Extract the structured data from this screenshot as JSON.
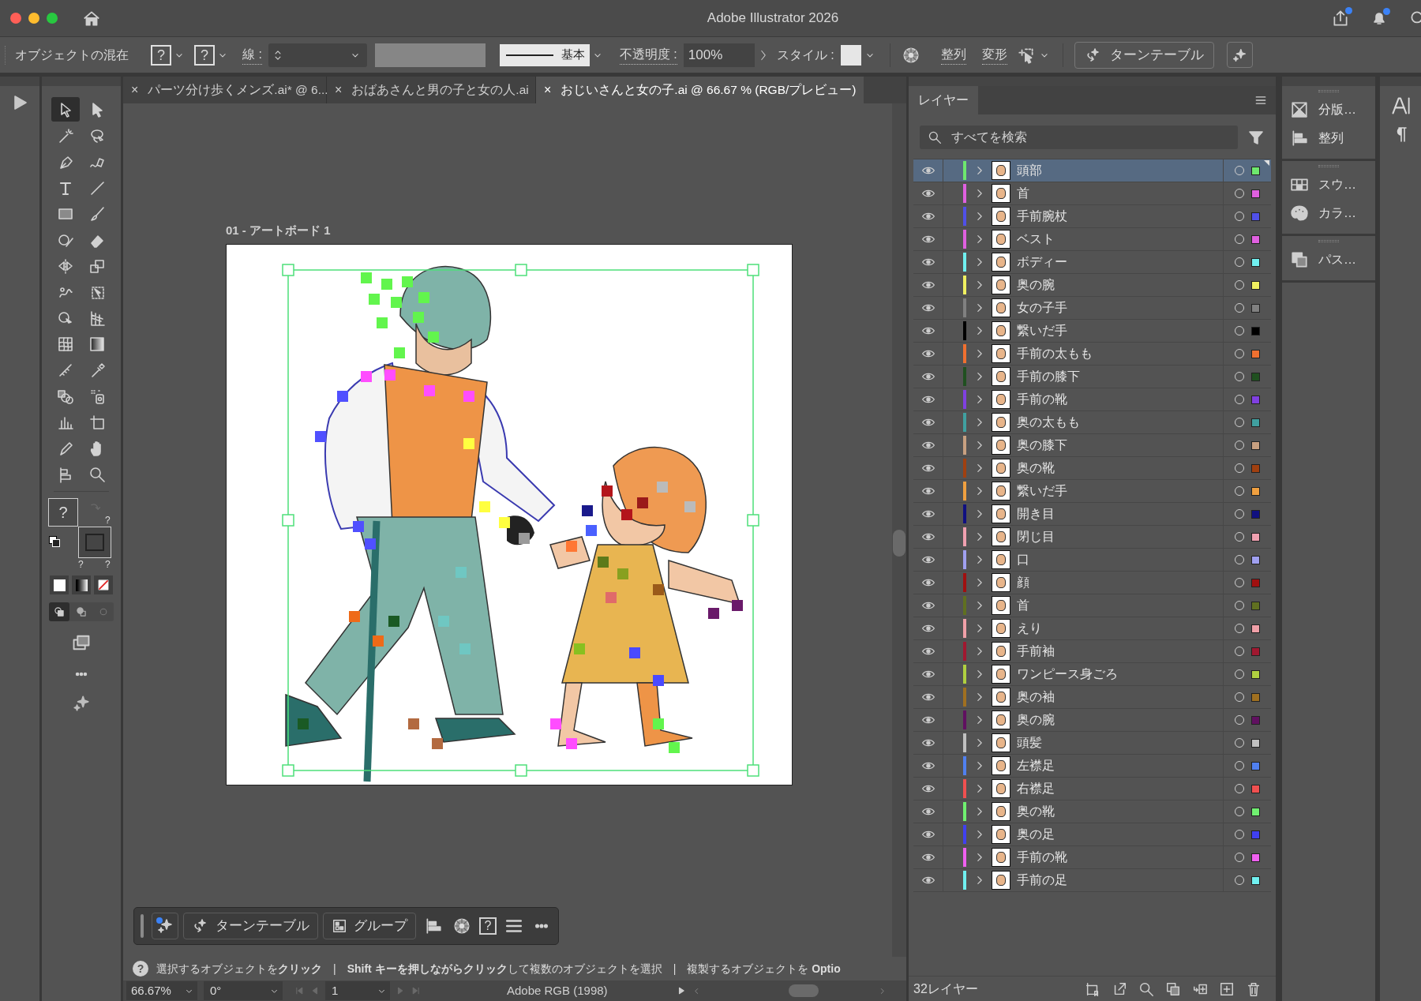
{
  "window": {
    "title": "Adobe Illustrator 2026"
  },
  "control_bar": {
    "selection_label": "オブジェクトの混在",
    "fill_swatch": "?",
    "stroke_swatch": "?",
    "stroke_label": "線 :",
    "profile": "基本",
    "opacity_label": "不透明度 :",
    "opacity": "100%",
    "style_label": "スタイル :",
    "align_link": "整列",
    "transform_link": "変形",
    "turntable_button": "ターンテーブル"
  },
  "document_tabs": [
    {
      "close": "×",
      "title": "パーツ分け歩くメンズ.ai* @ 6...",
      "selected": false
    },
    {
      "close": "×",
      "title": "おばあさんと男の子と女の人.ai",
      "selected": false
    },
    {
      "close": "×",
      "title": "おじいさんと女の子.ai @ 66.67 % (RGB/プレビュー)",
      "selected": true
    }
  ],
  "tools": [
    {
      "kind": "selection",
      "selected": true
    },
    {
      "kind": "direct",
      "selected": false
    },
    {
      "kind": "wand",
      "selected": false
    },
    {
      "kind": "lasso",
      "selected": false
    },
    {
      "kind": "pen",
      "selected": false
    },
    {
      "kind": "curvature",
      "selected": false
    },
    {
      "kind": "type",
      "selected": false
    },
    {
      "kind": "line",
      "selected": false
    },
    {
      "kind": "rect",
      "selected": false
    },
    {
      "kind": "brush",
      "selected": false
    },
    {
      "kind": "shaper",
      "selected": false
    },
    {
      "kind": "eraser",
      "selected": false
    },
    {
      "kind": "reflect",
      "selected": false
    },
    {
      "kind": "scale",
      "selected": false
    },
    {
      "kind": "puppet",
      "selected": false
    },
    {
      "kind": "freetransform",
      "selected": false
    },
    {
      "kind": "shapebuilder",
      "selected": false
    },
    {
      "kind": "perspective",
      "selected": false
    },
    {
      "kind": "mesh",
      "selected": false
    },
    {
      "kind": "gradient",
      "selected": false
    },
    {
      "kind": "measure",
      "selected": false
    },
    {
      "kind": "eyedropper",
      "selected": false
    },
    {
      "kind": "blend",
      "selected": false
    },
    {
      "kind": "sprayer",
      "selected": false
    },
    {
      "kind": "graph",
      "selected": false
    },
    {
      "kind": "artboard",
      "selected": false
    },
    {
      "kind": "pencil",
      "selected": false
    },
    {
      "kind": "hand",
      "selected": false
    },
    {
      "kind": "flag",
      "selected": false
    },
    {
      "kind": "zoom",
      "selected": false
    }
  ],
  "fill_stroke": {
    "fill": "?",
    "stroke": [
      "?",
      "?",
      "?"
    ]
  },
  "artboard": {
    "label": "01 - アートボード 1"
  },
  "taskbar": {
    "turntable": "ターンテーブル",
    "group": "グループ",
    "help": "?"
  },
  "hint": {
    "icon": "?",
    "text": "選択するオブジェクトを**クリック**　|　**Shift キーを押しながらクリック**して複数のオブジェクトを選択　|　複製するオブジェクトを **Optio**"
  },
  "status_bar": {
    "zoom": "66.67%",
    "rotation": "0°",
    "artboard": "1",
    "color_profile": "Adobe RGB (1998)"
  },
  "layers_panel": {
    "tab": "レイヤー",
    "search": {
      "placeholder": "すべてを検索"
    },
    "count": "32レイヤー",
    "layers": [
      {
        "name": "頭部",
        "color": "#6ee86e",
        "visible": true,
        "selected": true
      },
      {
        "name": "首",
        "color": "#e060e0",
        "visible": true,
        "selected": false
      },
      {
        "name": "手前腕杖",
        "color": "#5050e8",
        "visible": true,
        "selected": false
      },
      {
        "name": "ベスト",
        "color": "#e060e0",
        "visible": true,
        "selected": false
      },
      {
        "name": "ボディー",
        "color": "#70f0f0",
        "visible": true,
        "selected": false
      },
      {
        "name": "奥の腕",
        "color": "#f0f060",
        "visible": true,
        "selected": false
      },
      {
        "name": "女の子手",
        "color": "#808080",
        "visible": true,
        "selected": false
      },
      {
        "name": "繋いだ手",
        "color": "#000000",
        "visible": true,
        "selected": false
      },
      {
        "name": "手前の太もも",
        "color": "#f07030",
        "visible": true,
        "selected": false
      },
      {
        "name": "手前の膝下",
        "color": "#205020",
        "visible": true,
        "selected": false
      },
      {
        "name": "手前の靴",
        "color": "#8040e0",
        "visible": true,
        "selected": false
      },
      {
        "name": "奥の太もも",
        "color": "#40a0a0",
        "visible": true,
        "selected": false
      },
      {
        "name": "奥の膝下",
        "color": "#c8a080",
        "visible": true,
        "selected": false
      },
      {
        "name": "奥の靴",
        "color": "#a04010",
        "visible": true,
        "selected": false
      },
      {
        "name": "繋いだ手",
        "color": "#f0a040",
        "visible": true,
        "selected": false
      },
      {
        "name": "開き目",
        "color": "#101080",
        "visible": true,
        "selected": false
      },
      {
        "name": "閉じ目",
        "color": "#f0a0b0",
        "visible": true,
        "selected": false
      },
      {
        "name": "口",
        "color": "#a0a0f0",
        "visible": true,
        "selected": false
      },
      {
        "name": "顔",
        "color": "#a01010",
        "visible": true,
        "selected": false
      },
      {
        "name": "首",
        "color": "#607020",
        "visible": true,
        "selected": false
      },
      {
        "name": "えり",
        "color": "#f0a0a8",
        "visible": true,
        "selected": false
      },
      {
        "name": "手前袖",
        "color": "#a01830",
        "visible": true,
        "selected": false
      },
      {
        "name": "ワンピース身ごろ",
        "color": "#b0d040",
        "visible": true,
        "selected": false
      },
      {
        "name": "奥の袖",
        "color": "#a07020",
        "visible": true,
        "selected": false
      },
      {
        "name": "奥の腕",
        "color": "#601060",
        "visible": true,
        "selected": false
      },
      {
        "name": "頭髪",
        "color": "#c0c0c0",
        "visible": true,
        "selected": false
      },
      {
        "name": "左襟足",
        "color": "#5080f0",
        "visible": true,
        "selected": false
      },
      {
        "name": "右襟足",
        "color": "#f05050",
        "visible": true,
        "selected": false
      },
      {
        "name": "奥の靴",
        "color": "#70f070",
        "visible": true,
        "selected": false
      },
      {
        "name": "奥の足",
        "color": "#4040f0",
        "visible": true,
        "selected": false
      },
      {
        "name": "手前の靴",
        "color": "#f060f0",
        "visible": true,
        "selected": false
      },
      {
        "name": "手前の足",
        "color": "#70f0f0",
        "visible": true,
        "selected": false
      }
    ]
  },
  "side_panels": [
    {
      "label": "分版…",
      "kind": "separations"
    },
    {
      "label": "整列",
      "kind": "align"
    },
    {
      "label": "スウ…",
      "kind": "swatches"
    },
    {
      "label": "カラ…",
      "kind": "color"
    },
    {
      "label": "パス…",
      "kind": "pathfinder"
    }
  ]
}
